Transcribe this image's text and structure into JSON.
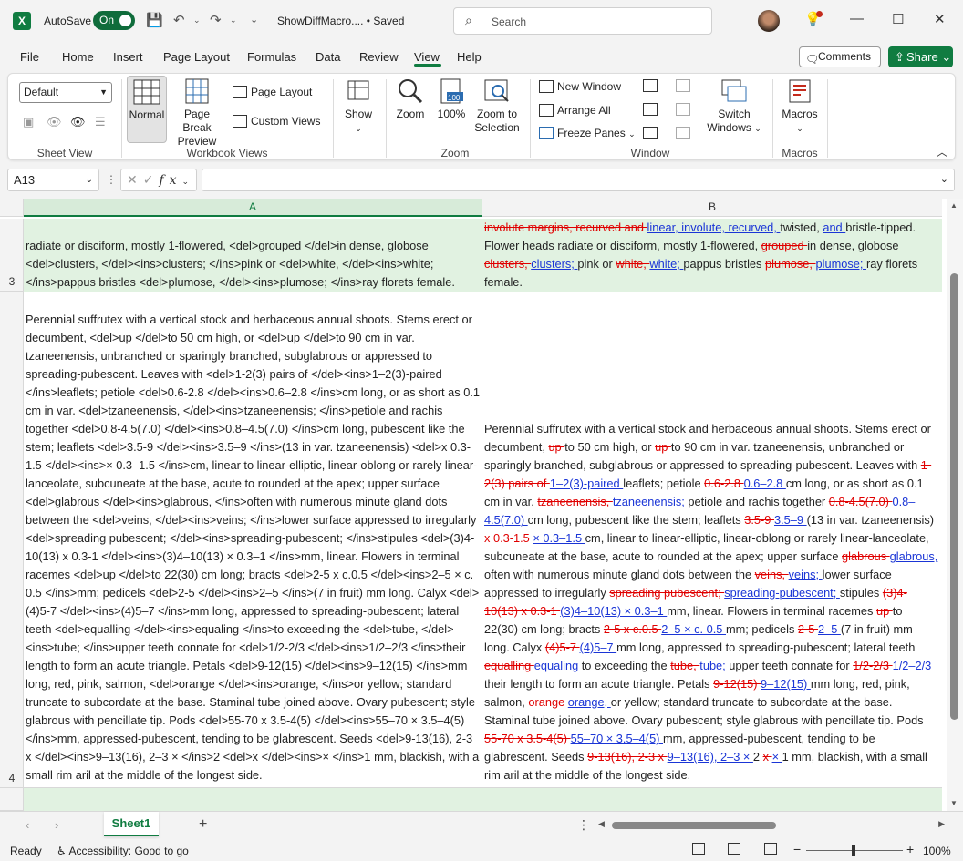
{
  "titlebar": {
    "autosave_label": "AutoSave",
    "autosave_state": "On",
    "doc_title": "ShowDiffMacro.... • Saved",
    "search_placeholder": "Search"
  },
  "menu": {
    "items": [
      "File",
      "Home",
      "Insert",
      "Page Layout",
      "Formulas",
      "Data",
      "Review",
      "View",
      "Help"
    ],
    "active": "View",
    "comments_label": "Comments",
    "share_label": "Share"
  },
  "ribbon": {
    "sheet_view": {
      "select_value": "Default",
      "label": "Sheet View"
    },
    "workbook_views": {
      "normal": "Normal",
      "page_break": "Page Break Preview",
      "page_layout": "Page Layout",
      "custom_views": "Custom Views",
      "label": "Workbook Views"
    },
    "show": {
      "label": "Show"
    },
    "zoom": {
      "zoom": "Zoom",
      "pct100": "100%",
      "zoom_to_selection": "Zoom to Selection",
      "label": "Zoom",
      "badge": "100"
    },
    "window": {
      "new_window": "New Window",
      "arrange_all": "Arrange All",
      "freeze_panes": "Freeze Panes",
      "switch_windows": "Switch Windows",
      "label": "Window"
    },
    "macros": {
      "macros": "Macros",
      "label": "Macros"
    }
  },
  "formula_bar": {
    "namebox": "A13",
    "formula": ""
  },
  "grid": {
    "col_a": "A",
    "col_b": "B",
    "row3": "3",
    "row4": "4"
  },
  "sheet_tabs": {
    "active": "Sheet1"
  },
  "status": {
    "ready": "Ready",
    "accessibility": "Accessibility: Good to go",
    "zoom": "100%"
  },
  "colors": {
    "accent": "#107c41",
    "deleted": "#e00000",
    "inserted": "#1a35d6",
    "row_highlight": "#e1f2e1"
  }
}
